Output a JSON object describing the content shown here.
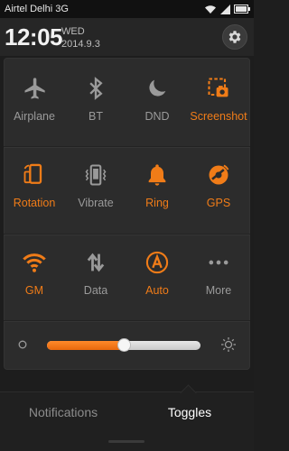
{
  "status_bar": {
    "carrier": "Airtel Delhi 3G",
    "icons": [
      "wifi-icon",
      "signal-icon",
      "battery-icon"
    ]
  },
  "header": {
    "time": "12:05",
    "day": "WED",
    "date": "2014.9.3",
    "settings_icon": "gear-icon"
  },
  "toggles": [
    {
      "label": "Airplane",
      "icon": "airplane-icon",
      "active": false
    },
    {
      "label": "BT",
      "icon": "bluetooth-icon",
      "active": false
    },
    {
      "label": "DND",
      "icon": "moon-icon",
      "active": false
    },
    {
      "label": "Screenshot",
      "icon": "screenshot-icon",
      "active": true
    },
    {
      "label": "Rotation",
      "icon": "rotation-icon",
      "active": true
    },
    {
      "label": "Vibrate",
      "icon": "vibrate-icon",
      "active": false
    },
    {
      "label": "Ring",
      "icon": "bell-icon",
      "active": true
    },
    {
      "label": "GPS",
      "icon": "gps-icon",
      "active": true
    },
    {
      "label": "GM",
      "icon": "wifi-icon",
      "active": true
    },
    {
      "label": "Data",
      "icon": "data-arrows-icon",
      "active": false
    },
    {
      "label": "Auto",
      "icon": "auto-brightness-icon",
      "active": true
    },
    {
      "label": "More",
      "icon": "more-dots-icon",
      "active": false
    }
  ],
  "brightness": {
    "level": 0.5,
    "low_icon": "brightness-low-icon",
    "high_icon": "brightness-high-icon"
  },
  "tabs": {
    "notifications": "Notifications",
    "toggles": "Toggles",
    "selected": "Toggles"
  },
  "colors": {
    "accent": "#f07c18",
    "inactive": "#9a9a9a",
    "panel": "#2c2c2c"
  }
}
